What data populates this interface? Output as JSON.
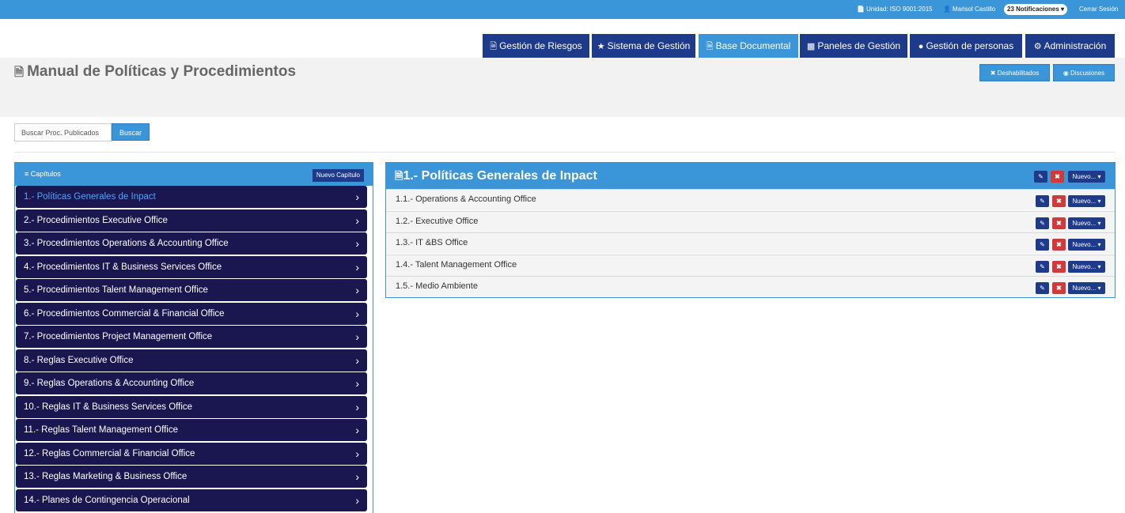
{
  "topbar": {
    "unidad": "Unidad: ISO 9001:2015",
    "user": "Marisol Castillo",
    "notifications": "23 Notificaciones",
    "logout": "Cerrar Sesión"
  },
  "nav": {
    "tabs": [
      {
        "label": "Gestión de Riesgos",
        "icon": "file-icon"
      },
      {
        "label": "Sistema de Gestión",
        "icon": "star-icon"
      },
      {
        "label": "Base Documental",
        "icon": "file-icon",
        "active": true
      },
      {
        "label": "Paneles de Gestión",
        "icon": "bar-chart-icon"
      },
      {
        "label": "Gestión de personas",
        "icon": "users-icon"
      },
      {
        "label": "Administración",
        "icon": "gears-icon"
      }
    ]
  },
  "header": {
    "title": "Manual de Políticas y Procedimientos",
    "deshabilitados": "Deshabilitados",
    "discusiones": "Discusiones"
  },
  "search": {
    "placeholder": "Buscar Proc. Publicados",
    "button": "Buscar"
  },
  "chapters": {
    "title": "Capítulos",
    "new_button": "Nuevo Capítulo",
    "items": [
      "1.- Políticas Generales de Inpact",
      "2.- Procedimientos Executive Office",
      "3.- Procedimientos Operations & Accounting Office",
      "4.- Procedimientos IT & Business Services Office",
      "5.- Procedimientos Talent Management Office",
      "6.- Procedimientos Commercial & Financial Office",
      "7.- Procedimientos Project Management Office",
      "8.- Reglas Executive Office",
      "9.- Reglas Operations & Accounting Office",
      "10.- Reglas IT & Business Services Office",
      "11.- Reglas Talent Management Office",
      "12.- Reglas Commercial & Financial Office",
      "13.- Reglas Marketing & Business Office",
      "14.- Planes de Contingencia Operacional"
    ]
  },
  "section": {
    "title": "1.- Políticas Generales de Inpact",
    "nuevo_label": "Nuevo...",
    "rows": [
      "1.1.- Operations & Accounting Office",
      "1.2.- Executive Office",
      "1.3.- IT &BS Office",
      "1.4.- Talent Management Office",
      "1.5.- Medio Ambiente"
    ]
  },
  "colors": {
    "primary": "#3a95d9",
    "dark_nav": "#1e3a8a",
    "chapter_bg": "#1a1650",
    "danger": "#d03a3a"
  }
}
